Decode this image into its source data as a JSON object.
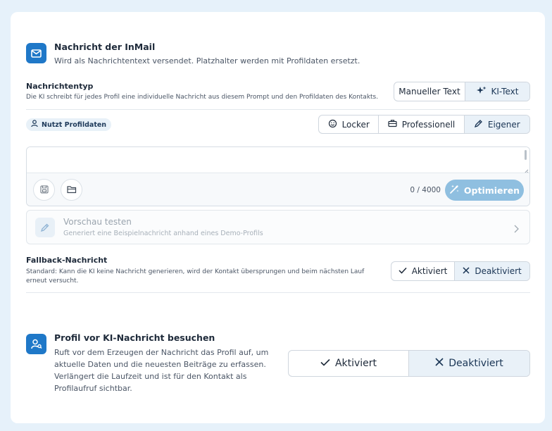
{
  "inmail": {
    "title": "Nachricht der InMail",
    "description": "Wird als Nachrichtentext versendet. Platzhalter werden mit Profildaten ersetzt."
  },
  "message_type": {
    "label": "Nachrichtentyp",
    "hint": "Die KI schreibt für jedes Profil eine individuelle Nachricht aus diesem Prompt und den Profildaten des Kontakts.",
    "options": [
      "Manueller Text",
      "KI-Text"
    ],
    "selected": "KI-Text"
  },
  "profile_badge": "Nutzt Profildaten",
  "tone": {
    "options": [
      "Locker",
      "Professionell",
      "Eigener"
    ],
    "selected": "Eigener"
  },
  "editor": {
    "value": "",
    "counter": "0 / 4000",
    "optimize_label": "Optimieren"
  },
  "preview": {
    "title": "Vorschau testen",
    "subtitle": "Generiert eine Beispielnachricht anhand eines Demo-Profils"
  },
  "fallback": {
    "label": "Fallback-Nachricht",
    "hint": "Standard: Kann die KI keine Nachricht generieren, wird der Kontakt übersprungen und beim nächsten Lauf erneut versucht.",
    "options": [
      "Aktiviert",
      "Deaktiviert"
    ],
    "selected": "Deaktiviert"
  },
  "profile_visit": {
    "title": "Profil vor KI-Nachricht besuchen",
    "description": "Ruft vor dem Erzeugen der Nachricht das Profil auf, um aktuelle Daten und die neuesten Beiträge zu erfassen. Verlängert die Laufzeit und ist für den Kontakt als Profilaufruf sichtbar.",
    "options": [
      "Aktiviert",
      "Deaktiviert"
    ],
    "selected": "Deaktiviert"
  },
  "colors": {
    "accent": "#1f78c8",
    "active_segment": "#e9f1f8",
    "optimize_button": "#8fbfe0",
    "background": "#e6f1fa"
  }
}
